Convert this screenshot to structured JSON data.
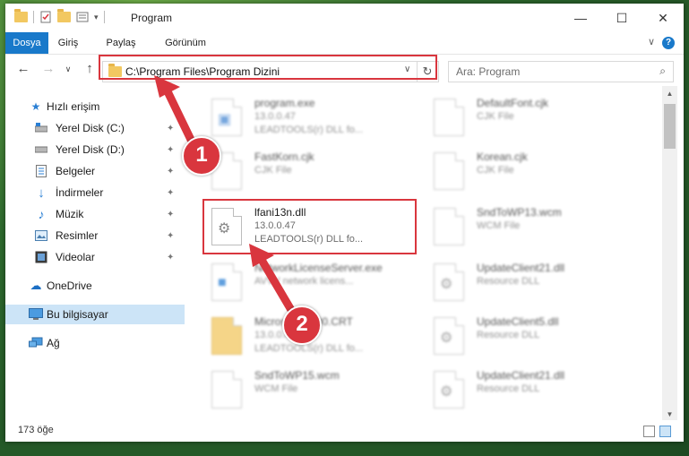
{
  "window": {
    "title": "Program",
    "controls": {
      "minimize": "—",
      "maximize": "☐",
      "close": "✕"
    }
  },
  "ribbon": {
    "tabs": [
      "Dosya",
      "Giriş",
      "Paylaş",
      "Görünüm"
    ],
    "active_tab": "Dosya",
    "help": "?",
    "expand": "∨"
  },
  "navigation": {
    "back": "←",
    "forward": "→",
    "recent": "∨",
    "up": "↑",
    "address": "C:\\Program Files\\Program Dizini",
    "address_dropdown": "∨",
    "refresh": "↻",
    "search_placeholder": "Ara: Program",
    "search_icon": "⌕"
  },
  "sidebar": {
    "items": [
      {
        "label": "Hızlı erişim",
        "icon": "star-icon",
        "pinned": false
      },
      {
        "label": "Yerel Disk (C:)",
        "icon": "drive-icon",
        "pinned": true
      },
      {
        "label": "Yerel Disk (D:)",
        "icon": "drive-icon",
        "pinned": true
      },
      {
        "label": "Belgeler",
        "icon": "documents-icon",
        "pinned": true
      },
      {
        "label": "İndirmeler",
        "icon": "download-icon",
        "pinned": true
      },
      {
        "label": "Müzik",
        "icon": "music-icon",
        "pinned": true
      },
      {
        "label": "Resimler",
        "icon": "pictures-icon",
        "pinned": true
      },
      {
        "label": "Videolar",
        "icon": "videos-icon",
        "pinned": true
      },
      {
        "label": "OneDrive",
        "icon": "cloud-icon",
        "pinned": false
      },
      {
        "label": "Bu bilgisayar",
        "icon": "computer-icon",
        "pinned": false,
        "selected": true
      },
      {
        "label": "Ağ",
        "icon": "network-icon",
        "pinned": false
      }
    ],
    "pin_glyph": "📌"
  },
  "files": [
    {
      "name": "program.exe",
      "line2": "13.0.0.47",
      "line3": "LEADTOOLS(r) DLL fo...",
      "blurred": true
    },
    {
      "name": "DefaultFont.cjk",
      "line2": "CJK File",
      "line3": "",
      "blurred": true
    },
    {
      "name": "FastKorn.cjk",
      "line2": "CJK File",
      "line3": "",
      "blurred": true
    },
    {
      "name": "Korean.cjk",
      "line2": "CJK File",
      "line3": "",
      "blurred": true
    },
    {
      "name": "lfani13n.dll",
      "line2": "13.0.0.47",
      "line3": "LEADTOOLS(r) DLL fo...",
      "blurred": false
    },
    {
      "name": "SndToWP13.wcm",
      "line2": "WCM File",
      "line3": "",
      "blurred": true
    },
    {
      "name": "NetworkLicenseServer.exe",
      "line2": "AVVV network licens...",
      "line3": "",
      "blurred": true
    },
    {
      "name": "UpdateClient21.dll",
      "line2": "Resource DLL",
      "line3": "",
      "blurred": true
    },
    {
      "name": "Microsoft.VC90.CRT",
      "line2": "13.0.0.47",
      "line3": "LEADTOOLS(r) DLL fo...",
      "blurred": true
    },
    {
      "name": "UpdateClient5.dll",
      "line2": "Resource DLL",
      "line3": "",
      "blurred": true
    },
    {
      "name": "SndToWP15.wcm",
      "line2": "WCM File",
      "line3": "",
      "blurred": true
    },
    {
      "name": "UpdateClient21.dll",
      "line2": "Resource DLL",
      "line3": "",
      "blurred": true
    }
  ],
  "status": {
    "item_count": "173 öğe"
  },
  "annotations": {
    "step1": "1",
    "step2": "2",
    "color": "#d9363e"
  }
}
